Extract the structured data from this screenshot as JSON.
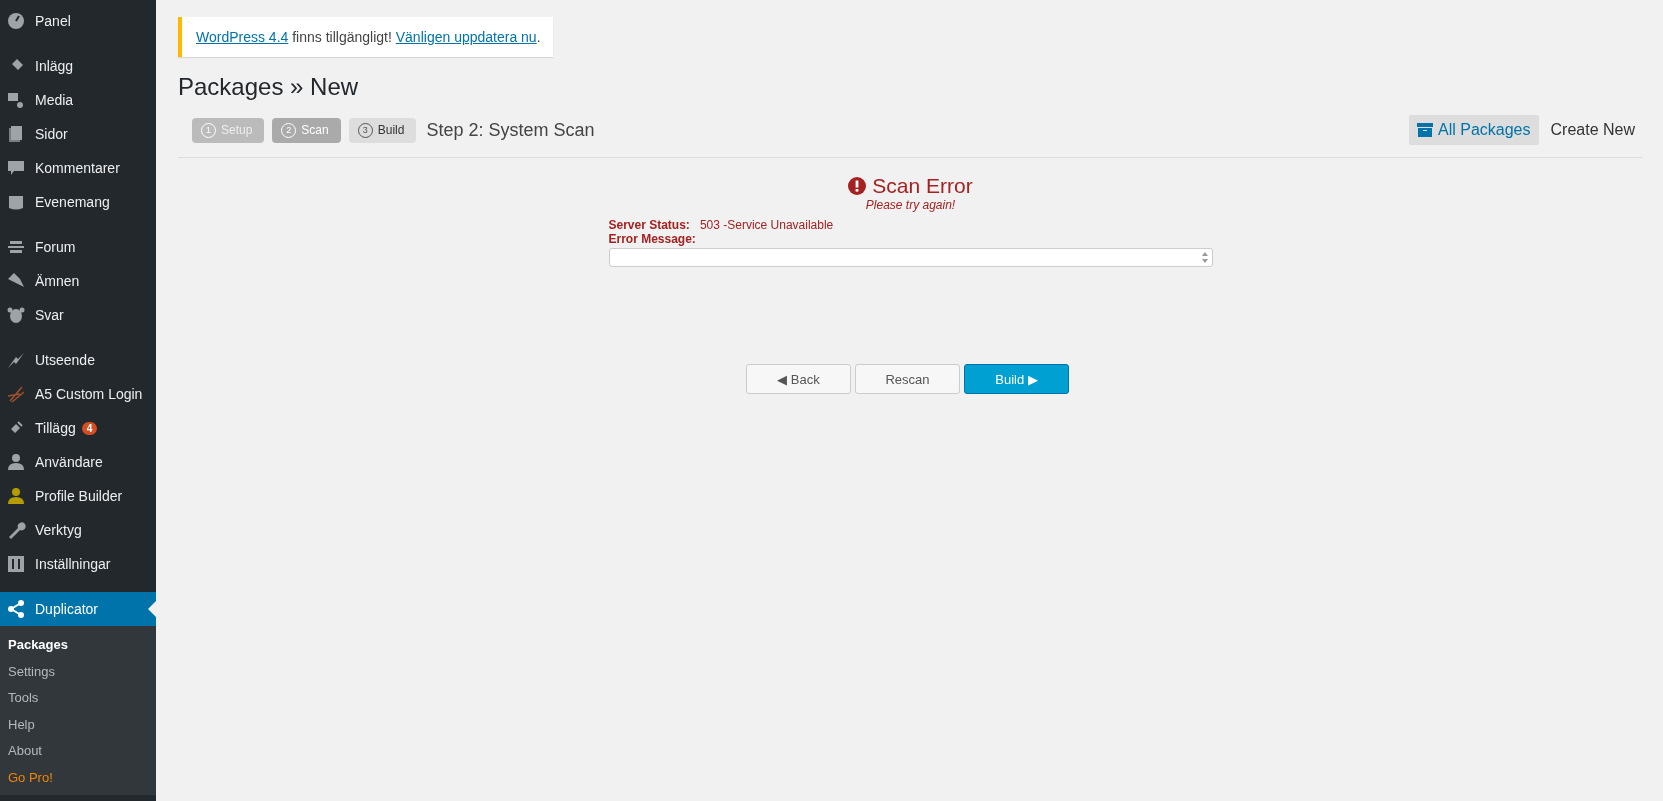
{
  "sidebar": {
    "groups": [
      {
        "items": [
          {
            "label": "Panel",
            "selected": false
          }
        ]
      },
      {
        "items": [
          {
            "label": "Inlägg",
            "selected": false
          },
          {
            "label": "Media",
            "selected": false
          },
          {
            "label": "Sidor",
            "selected": false
          },
          {
            "label": "Kommentarer",
            "selected": false
          },
          {
            "label": "Evenemang",
            "selected": false
          }
        ]
      },
      {
        "items": [
          {
            "label": "Forum",
            "selected": false
          },
          {
            "label": "Ämnen",
            "selected": false
          },
          {
            "label": "Svar",
            "selected": false
          }
        ]
      },
      {
        "items": [
          {
            "label": "Utseende",
            "selected": false
          },
          {
            "label": "A5 Custom Login",
            "selected": false
          },
          {
            "label": "Tillägg",
            "badge": "4",
            "selected": false
          },
          {
            "label": "Användare",
            "selected": false
          },
          {
            "label": "Profile Builder",
            "selected": false
          },
          {
            "label": "Verktyg",
            "selected": false
          },
          {
            "label": "Inställningar",
            "selected": false
          }
        ]
      },
      {
        "items": [
          {
            "label": "Duplicator",
            "selected": true,
            "children": [
              {
                "label": "Packages",
                "selected": true,
                "kind": "link"
              },
              {
                "label": "Settings",
                "selected": false,
                "kind": "link"
              },
              {
                "label": "Tools",
                "selected": false,
                "kind": "link"
              },
              {
                "label": "Help",
                "selected": false,
                "kind": "link"
              },
              {
                "label": "About",
                "selected": false,
                "kind": "link"
              },
              {
                "label": "Go Pro!",
                "selected": false,
                "kind": "promo"
              }
            ]
          }
        ]
      }
    ]
  },
  "notice": {
    "parts": [
      {
        "kind": "link",
        "text": "WordPress 4.4"
      },
      {
        "kind": "text",
        "text": " finns tillgängligt! "
      },
      {
        "kind": "link",
        "text": "Vänligen uppdatera nu"
      },
      {
        "kind": "text",
        "text": "."
      }
    ]
  },
  "page_title": "Packages » New",
  "steps": [
    {
      "number": "1",
      "label": "Setup",
      "kind": "done"
    },
    {
      "number": "2",
      "label": "Scan",
      "kind": "active"
    },
    {
      "number": "3",
      "label": "Build",
      "kind": "todo"
    }
  ],
  "step_title": "Step 2: System Scan",
  "header_links": [
    {
      "label": "All Packages",
      "selected": true
    },
    {
      "label": "Create New",
      "selected": false
    }
  ],
  "error": {
    "title": "Scan Error",
    "subtitle": "Please try again!",
    "fields": [
      {
        "label": "Server Status:",
        "value": "503 -Service Unavailable"
      }
    ],
    "message_label": "Error Message:"
  },
  "buttons": [
    {
      "label": "◀ Back",
      "kind": "secondary"
    },
    {
      "label": "Rescan",
      "kind": "secondary"
    },
    {
      "label": "Build ▶",
      "kind": "primary"
    }
  ]
}
